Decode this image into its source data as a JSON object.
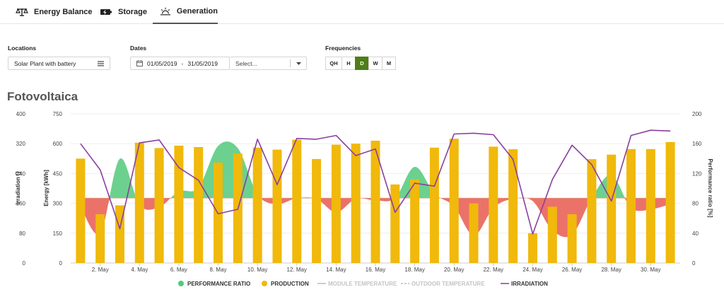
{
  "tabs": [
    {
      "label": "Energy Balance",
      "icon": "scale-icon",
      "active": false
    },
    {
      "label": "Storage",
      "icon": "battery-icon",
      "active": false
    },
    {
      "label": "Generation",
      "icon": "sun-icon",
      "active": true
    }
  ],
  "filters": {
    "locations_label": "Locations",
    "locations_value": "Solar Plant with battery",
    "dates_label": "Dates",
    "date_from": "01/05/2019",
    "date_sep": "-",
    "date_to": "31/05/2019",
    "compare_placeholder": "Select...",
    "frequencies_label": "Frequencies",
    "frequencies": [
      "QH",
      "H",
      "D",
      "W",
      "M"
    ],
    "frequency_selected": "D"
  },
  "colors": {
    "accent": "#4e7e16",
    "performance_ratio_pos": "#52c97a",
    "performance_ratio_neg": "#e8594f",
    "production": "#f0b90b",
    "irradiation": "#8a3fa0",
    "muted": "#bbbbbb"
  },
  "chart_data": {
    "type": "bar",
    "title": "Fotovoltaica",
    "axes": {
      "irradiation": {
        "label": "Irradiation []",
        "ticks": [
          0,
          80,
          160,
          240,
          320,
          400
        ],
        "range": [
          0,
          400
        ]
      },
      "energy": {
        "label": "Energy [kWh]",
        "ticks": [
          0,
          150,
          300,
          450,
          600,
          750
        ],
        "range": [
          0,
          750
        ]
      },
      "performance": {
        "label": "Performance ratio [%]",
        "ticks": [
          0,
          40,
          80,
          120,
          160,
          200
        ],
        "range": [
          0,
          200
        ]
      }
    },
    "x_tick_labels": [
      "2. May",
      "4. May",
      "6. May",
      "8. May",
      "10. May",
      "12. May",
      "14. May",
      "16. May",
      "18. May",
      "20. May",
      "22. May",
      "24. May",
      "26. May",
      "28. May",
      "30. May"
    ],
    "days": [
      1,
      2,
      3,
      4,
      5,
      6,
      7,
      8,
      9,
      10,
      11,
      12,
      13,
      14,
      15,
      16,
      17,
      18,
      19,
      20,
      21,
      22,
      23,
      24,
      25,
      26,
      27,
      28,
      29,
      30,
      31
    ],
    "performance_baseline": 87,
    "series": [
      {
        "name": "PERFORMANCE RATIO",
        "axis": "performance",
        "type": "area",
        "values": [
          76,
          40,
          140,
          78,
          75,
          96,
          101,
          157,
          154,
          92,
          79,
          87,
          86,
          68,
          86,
          84,
          87,
          129,
          93,
          76,
          37,
          74,
          86,
          83,
          44,
          38,
          87,
          118,
          74,
          72,
          79
        ]
      },
      {
        "name": "PRODUCTION",
        "axis": "energy",
        "type": "bar",
        "values": [
          525,
          245,
          290,
          605,
          578,
          590,
          583,
          505,
          550,
          580,
          570,
          620,
          523,
          595,
          600,
          615,
          395,
          420,
          580,
          625,
          300,
          585,
          572,
          150,
          283,
          245,
          522,
          545,
          573,
          573,
          608
        ]
      },
      {
        "name": "MODULE TEMPERATURE",
        "type": "line",
        "values": [],
        "visible": false
      },
      {
        "name": "OUTDOOR TEMPERATURE",
        "type": "line",
        "values": [],
        "visible": false
      },
      {
        "name": "IRRADIATION",
        "axis": "performance",
        "type": "line",
        "values": [
          160,
          125,
          46,
          161,
          165,
          128,
          111,
          66,
          72,
          166,
          105,
          167,
          166,
          171,
          144,
          153,
          68,
          107,
          103,
          173,
          174,
          172,
          139,
          39,
          112,
          158,
          132,
          83,
          171,
          178,
          177
        ]
      }
    ],
    "legend": {
      "position": "bottom",
      "items": [
        {
          "label": "PERFORMANCE RATIO",
          "marker": "dot",
          "color": "#52c97a",
          "active": true
        },
        {
          "label": "PRODUCTION",
          "marker": "dot",
          "color": "#f0b90b",
          "active": true
        },
        {
          "label": "MODULE TEMPERATURE",
          "marker": "line",
          "color": "#bbbbbb",
          "active": false
        },
        {
          "label": "OUTDOOR TEMPERATURE",
          "marker": "dash",
          "color": "#bbbbbb",
          "active": false
        },
        {
          "label": "IRRADIATION",
          "marker": "line",
          "color": "#8a3fa0",
          "active": true
        }
      ]
    }
  }
}
